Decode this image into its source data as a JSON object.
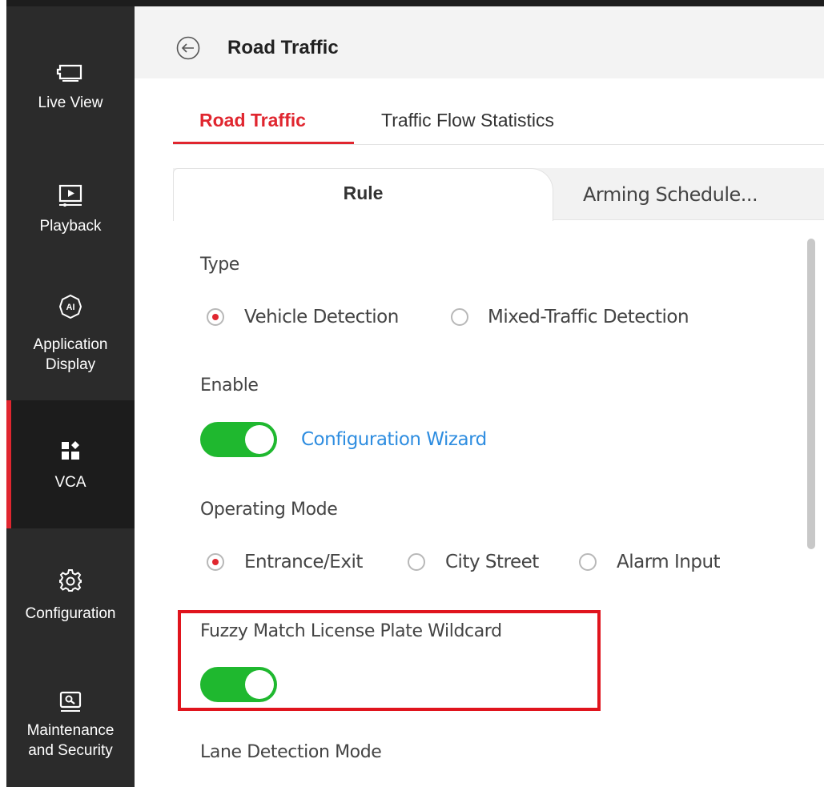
{
  "sidebar": {
    "items": [
      {
        "label": "Live View",
        "icon": "monitor-icon"
      },
      {
        "label": "Playback",
        "icon": "playback-icon"
      },
      {
        "label_line1": "Application",
        "label_line2": "Display",
        "icon": "ai-icon"
      },
      {
        "label": "VCA",
        "icon": "vca-grid-icon",
        "active": true
      },
      {
        "label": "Configuration",
        "icon": "gear-icon"
      },
      {
        "label_line1": "Maintenance",
        "label_line2": "and Security",
        "icon": "maintenance-icon"
      }
    ]
  },
  "header": {
    "title": "Road Traffic"
  },
  "tabs": [
    {
      "label": "Road Traffic",
      "active": true
    },
    {
      "label": "Traffic Flow Statistics"
    }
  ],
  "subtabs": [
    {
      "label": "Rule",
      "active": true
    },
    {
      "label": "Arming Schedule..."
    }
  ],
  "form": {
    "type_label": "Type",
    "type_options": [
      {
        "label": "Vehicle Detection",
        "selected": true
      },
      {
        "label": "Mixed-Traffic Detection",
        "selected": false
      }
    ],
    "enable_label": "Enable",
    "enable_on": true,
    "wizard_link": "Configuration Wizard",
    "operating_mode_label": "Operating Mode",
    "operating_mode_options": [
      {
        "label": "Entrance/Exit",
        "selected": true
      },
      {
        "label": "City Street",
        "selected": false
      },
      {
        "label": "Alarm Input",
        "selected": false
      }
    ],
    "fuzzy_match_label": "Fuzzy Match License Plate Wildcard",
    "fuzzy_match_on": true,
    "lane_detection_label": "Lane Detection Mode"
  },
  "colors": {
    "accent": "#e0262f",
    "toggle_on": "#1fb82f",
    "link": "#2e8de0",
    "sidebar_bg": "#2b2b2b",
    "highlight": "#e0141d"
  }
}
